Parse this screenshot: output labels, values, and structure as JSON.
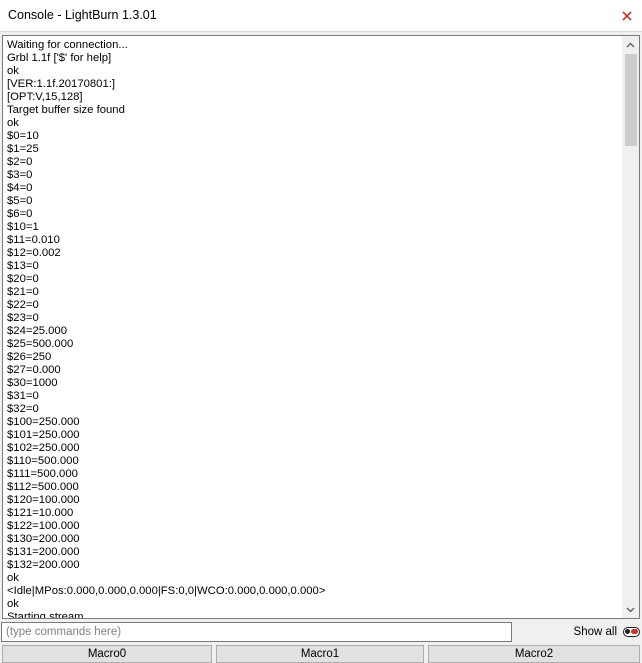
{
  "window": {
    "title": "Console - LightBurn 1.3.01"
  },
  "console": {
    "lines": [
      "Waiting for connection...",
      "Grbl 1.1f ['$' for help]",
      "ok",
      "[VER:1.1f.20170801:]",
      "[OPT:V,15,128]",
      "Target buffer size found",
      "ok",
      "$0=10",
      "$1=25",
      "$2=0",
      "$3=0",
      "$4=0",
      "$5=0",
      "$6=0",
      "$10=1",
      "$11=0.010",
      "$12=0.002",
      "$13=0",
      "$20=0",
      "$21=0",
      "$22=0",
      "$23=0",
      "$24=25.000",
      "$25=500.000",
      "$26=250",
      "$27=0.000",
      "$30=1000",
      "$31=0",
      "$32=0",
      "$100=250.000",
      "$101=250.000",
      "$102=250.000",
      "$110=500.000",
      "$111=500.000",
      "$112=500.000",
      "$120=100.000",
      "$121=10.000",
      "$122=100.000",
      "$130=200.000",
      "$131=200.000",
      "$132=200.000",
      "ok",
      "<Idle|MPos:0.000,0.000,0.000|FS:0,0|WCO:0.000,0.000,0.000>",
      "ok",
      "Starting stream"
    ]
  },
  "command": {
    "value": "",
    "placeholder": "(type commands here)"
  },
  "show_all": {
    "label": "Show all",
    "enabled": false
  },
  "macros": {
    "m0": "Macro0",
    "m1": "Macro1",
    "m2": "Macro2"
  },
  "colors": {
    "toggle_accent": "#c0392b",
    "button_face": "#e1e1e1"
  }
}
